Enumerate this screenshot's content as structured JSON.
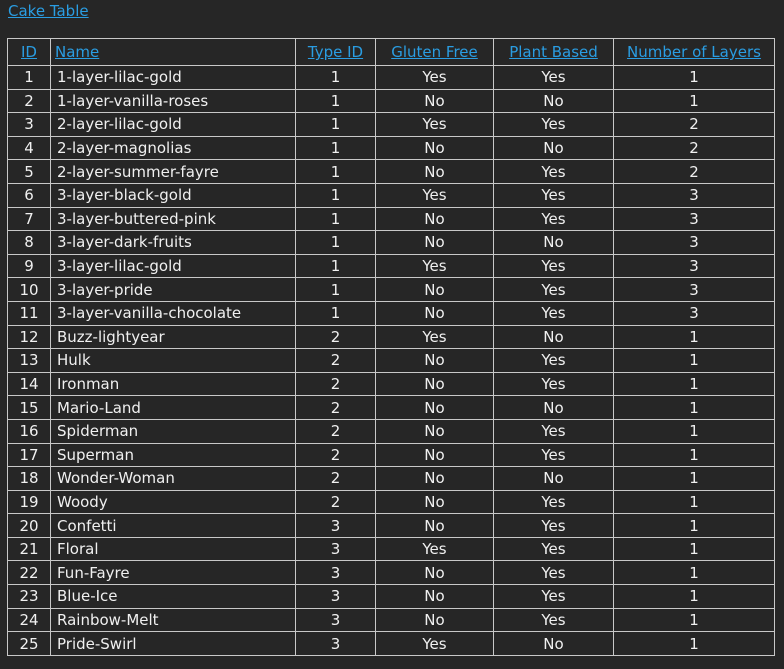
{
  "title_link": "Cake Table",
  "table": {
    "headers": [
      "ID",
      "Name",
      "Type ID",
      "Gluten Free",
      "Plant Based",
      "Number of Layers"
    ],
    "rows": [
      [
        "1",
        "1-layer-lilac-gold",
        "1",
        "Yes",
        "Yes",
        "1"
      ],
      [
        "2",
        "1-layer-vanilla-roses",
        "1",
        "No",
        "No",
        "1"
      ],
      [
        "3",
        "2-layer-lilac-gold",
        "1",
        "Yes",
        "Yes",
        "2"
      ],
      [
        "4",
        "2-layer-magnolias",
        "1",
        "No",
        "No",
        "2"
      ],
      [
        "5",
        "2-layer-summer-fayre",
        "1",
        "No",
        "Yes",
        "2"
      ],
      [
        "6",
        "3-layer-black-gold",
        "1",
        "Yes",
        "Yes",
        "3"
      ],
      [
        "7",
        "3-layer-buttered-pink",
        "1",
        "No",
        "Yes",
        "3"
      ],
      [
        "8",
        "3-layer-dark-fruits",
        "1",
        "No",
        "No",
        "3"
      ],
      [
        "9",
        "3-layer-lilac-gold",
        "1",
        "Yes",
        "Yes",
        "3"
      ],
      [
        "10",
        "3-layer-pride",
        "1",
        "No",
        "Yes",
        "3"
      ],
      [
        "11",
        "3-layer-vanilla-chocolate",
        "1",
        "No",
        "Yes",
        "3"
      ],
      [
        "12",
        "Buzz-lightyear",
        "2",
        "Yes",
        "No",
        "1"
      ],
      [
        "13",
        "Hulk",
        "2",
        "No",
        "Yes",
        "1"
      ],
      [
        "14",
        "Ironman",
        "2",
        "No",
        "Yes",
        "1"
      ],
      [
        "15",
        "Mario-Land",
        "2",
        "No",
        "No",
        "1"
      ],
      [
        "16",
        "Spiderman",
        "2",
        "No",
        "Yes",
        "1"
      ],
      [
        "17",
        "Superman",
        "2",
        "No",
        "Yes",
        "1"
      ],
      [
        "18",
        "Wonder-Woman",
        "2",
        "No",
        "No",
        "1"
      ],
      [
        "19",
        "Woody",
        "2",
        "No",
        "Yes",
        "1"
      ],
      [
        "20",
        "Confetti",
        "3",
        "No",
        "Yes",
        "1"
      ],
      [
        "21",
        "Floral",
        "3",
        "Yes",
        "Yes",
        "1"
      ],
      [
        "22",
        "Fun-Fayre",
        "3",
        "No",
        "Yes",
        "1"
      ],
      [
        "23",
        "Blue-Ice",
        "3",
        "No",
        "Yes",
        "1"
      ],
      [
        "24",
        "Rainbow-Melt",
        "3",
        "No",
        "Yes",
        "1"
      ],
      [
        "25",
        "Pride-Swirl",
        "3",
        "Yes",
        "No",
        "1"
      ]
    ]
  },
  "colors": {
    "background": "#262626",
    "link": "#2a9de2",
    "text": "#f0f0f0",
    "border": "#c8c8c8"
  }
}
